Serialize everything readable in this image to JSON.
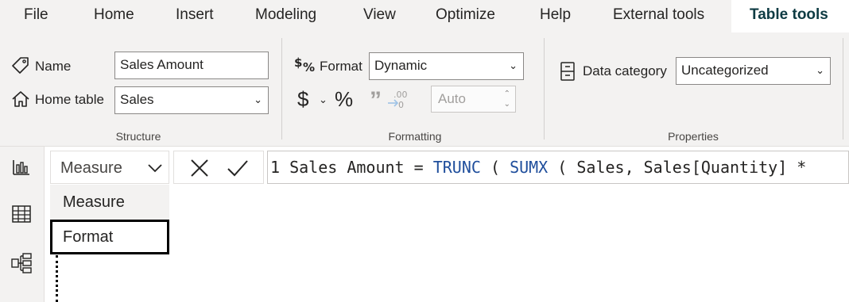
{
  "menu": {
    "items": [
      "File",
      "Home",
      "Insert",
      "Modeling",
      "View",
      "Optimize",
      "Help",
      "External tools",
      "Table tools"
    ],
    "active": "Table tools"
  },
  "structure": {
    "group_label": "Structure",
    "name_label": "Name",
    "name_value": "Sales Amount",
    "home_table_label": "Home table",
    "home_table_value": "Sales"
  },
  "formatting": {
    "group_label": "Formatting",
    "format_label": "Format",
    "format_value": "Dynamic",
    "currency_symbol": "$",
    "percent_symbol": "%",
    "comma_symbol": "”",
    "decimal_places": "Auto"
  },
  "properties": {
    "group_label": "Properties",
    "data_category_label": "Data category",
    "data_category_value": "Uncategorized"
  },
  "formula_bar": {
    "property_selector_value": "Measure",
    "line_number": "1",
    "formula_parts": [
      "Sales Amount = ",
      "TRUNC",
      " ( ",
      "SUMX",
      " ( Sales, Sales[Quantity] * "
    ]
  },
  "property_dropdown": {
    "options": [
      "Measure",
      "Format"
    ],
    "hovered": "Measure",
    "focused": "Format"
  },
  "colors": {
    "ribbon_bg": "#f3f2f1",
    "active_tab_text": "#0e3b43",
    "keyword": "#1f4e9c"
  },
  "icons": [
    "tag-icon",
    "home-icon",
    "dollar-percent-icon",
    "dollar-icon",
    "percent-icon",
    "comma-icon",
    "decimal-icon",
    "data-category-icon",
    "report-view-icon",
    "table-view-icon",
    "model-view-icon",
    "cancel-icon",
    "commit-icon",
    "chevron-down-icon"
  ]
}
